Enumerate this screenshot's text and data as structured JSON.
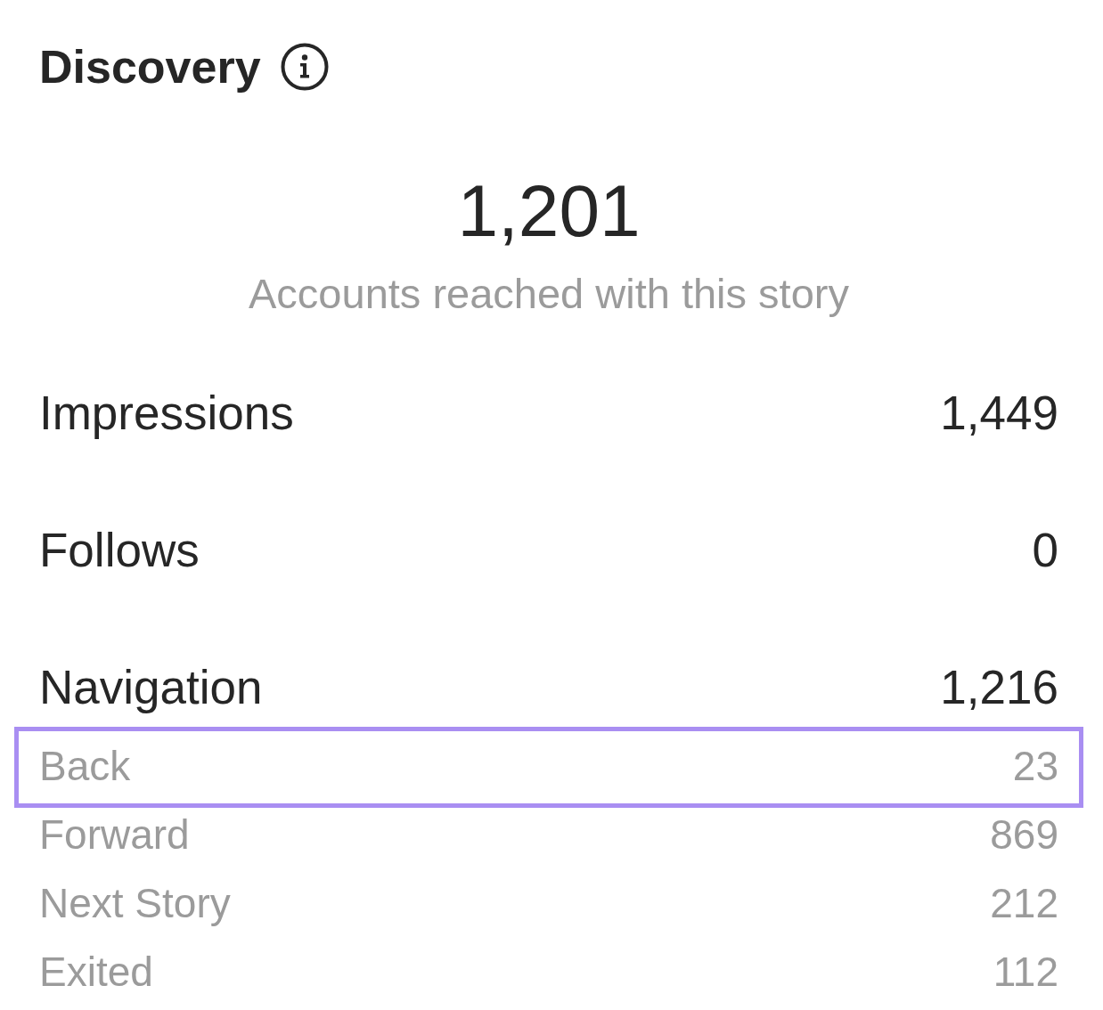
{
  "section": {
    "title": "Discovery"
  },
  "reach": {
    "value": "1,201",
    "caption": "Accounts reached with this story"
  },
  "metrics": [
    {
      "label": "Impressions",
      "value": "1,449"
    },
    {
      "label": "Follows",
      "value": "0"
    },
    {
      "label": "Navigation",
      "value": "1,216",
      "breakdown": [
        {
          "label": "Back",
          "value": "23",
          "highlighted": true
        },
        {
          "label": "Forward",
          "value": "869",
          "highlighted": false
        },
        {
          "label": "Next Story",
          "value": "212",
          "highlighted": false
        },
        {
          "label": "Exited",
          "value": "112",
          "highlighted": false
        }
      ]
    }
  ]
}
